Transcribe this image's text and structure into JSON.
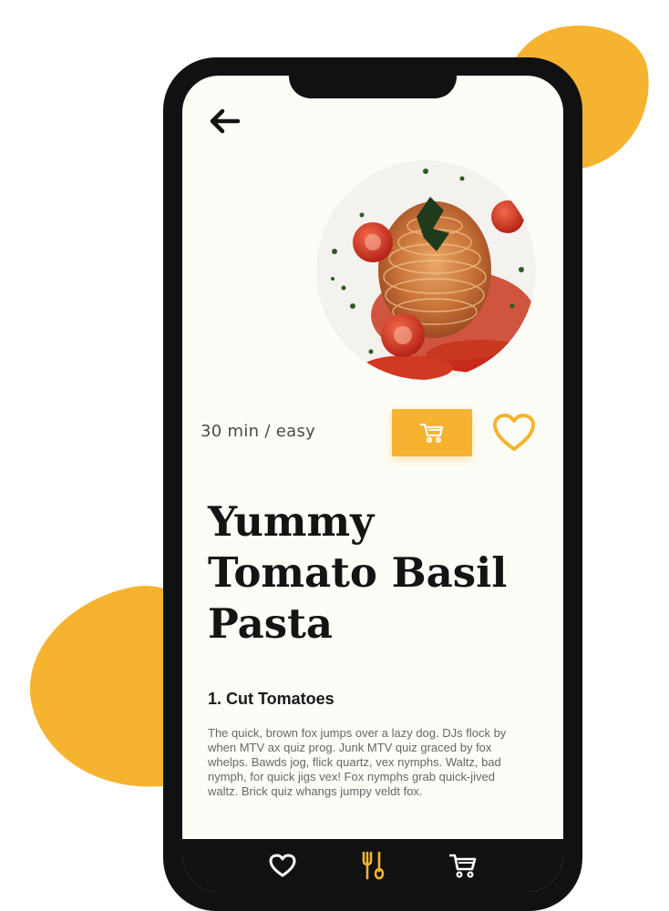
{
  "recipe": {
    "meta": "30 min / easy",
    "title_lines": [
      "Yummy",
      "Tomato Basil",
      "Pasta"
    ]
  },
  "steps": [
    {
      "title": "1. Cut Tomatoes",
      "body": "The quick, brown fox jumps over a lazy dog. DJs flock by when MTV ax quiz prog. Junk MTV quiz graced by fox whelps. Bawds jog, flick quartz, vex nymphs. Waltz, bad nymph, for quick jigs vex! Fox nymphs grab quick-jived waltz. Brick quiz whangs jumpy veldt fox."
    }
  ],
  "icons": {
    "back": "arrow-left-icon",
    "cart": "cart-icon",
    "favorite": "heart-icon",
    "nav": [
      "heart-icon",
      "utensils-icon",
      "cart-icon"
    ]
  },
  "colors": {
    "accent": "#f6b330",
    "phone_frame": "#111111",
    "screen_bg": "#fdfdf7",
    "text_dark": "#141414",
    "text_muted": "#666666"
  }
}
